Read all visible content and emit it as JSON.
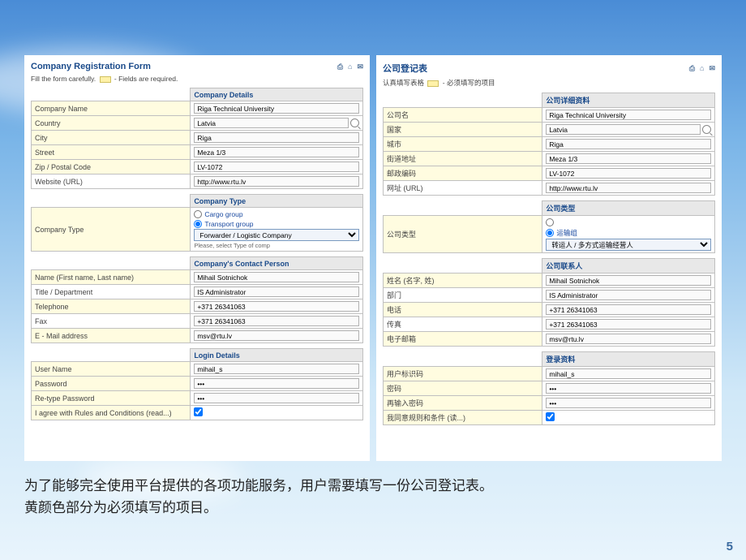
{
  "left": {
    "title": "Company Registration Form",
    "careful_pre": "Fill the form carefully.",
    "careful_post": "- Fields are required.",
    "sec_details": "Company Details",
    "f_name": "Company Name",
    "v_name": "Riga Technical University",
    "f_country": "Country",
    "v_country": "Latvia",
    "f_city": "City",
    "v_city": "Riga",
    "f_street": "Street",
    "v_street": "Meza 1/3",
    "f_zip": "Zip / Postal Code",
    "v_zip": "LV-1072",
    "f_url": "Website (URL)",
    "v_url": "http://www.rtu.lv",
    "sec_type": "Company Type",
    "f_ctype": "Company Type",
    "r_cargo": "Cargo group",
    "r_transport": "Transport group",
    "sel_type": "Forwarder / Logistic Company",
    "hint_sel": "Please, select Type of comp",
    "sec_contact": "Company's Contact Person",
    "f_cname": "Name (First name, Last name)",
    "v_cname": "Mihail Sotnichok",
    "f_dept": "Title / Department",
    "v_dept": "IS Administrator",
    "f_tel": "Telephone",
    "v_tel": "+371 26341063",
    "f_fax": "Fax",
    "v_fax": "+371 26341063",
    "f_email": "E - Mail address",
    "v_email": "msv@rtu.lv",
    "sec_login": "Login Details",
    "f_user": "User Name",
    "v_user": "mihail_s",
    "f_pass": "Password",
    "v_pass": "•••",
    "f_pass2": "Re-type Password",
    "v_pass2": "•••",
    "f_agree": "I agree with Rules and Conditions (read...)"
  },
  "right": {
    "title": "公司登记表",
    "careful_pre": "认真填写表格",
    "careful_post": "- 必须填写的项目",
    "sec_details": "公司详细资料",
    "f_name": "公司名",
    "v_name": "Riga Technical University",
    "f_country": "国家",
    "v_country": "Latvia",
    "f_city": "城市",
    "v_city": "Riga",
    "f_street": "街道地址",
    "v_street": "Meza 1/3",
    "f_zip": "邮政编码",
    "v_zip": "LV-1072",
    "f_url": "网址 (URL)",
    "v_url": "http://www.rtu.lv",
    "sec_type": "公司类型",
    "f_ctype": "公司类型",
    "r_transport": "运输组",
    "sel_type": "转运人 / 多方式运输经营人",
    "sec_contact": "公司联系人",
    "f_cname": "姓名 (名字, 姓)",
    "v_cname": "Mihail Sotnichok",
    "f_dept": "部门",
    "v_dept": "IS Administrator",
    "f_tel": "电话",
    "v_tel": "+371 26341063",
    "f_fax": "传真",
    "v_fax": "+371 26341063",
    "f_email": "电子邮箱",
    "v_email": "msv@rtu.lv",
    "sec_login": "登录资料",
    "f_user": "用户标识码",
    "v_user": "mihail_s",
    "f_pass": "密码",
    "v_pass": "•••",
    "f_pass2": "再输入密码",
    "v_pass2": "•••",
    "f_agree": "我同意规则和条件 (读...)"
  },
  "caption_l1": "为了能够完全使用平台提供的各项功能服务，用户需要填写一份公司登记表。",
  "caption_l2": "黄颜色部分为必须填写的项目。",
  "page_num": "5"
}
